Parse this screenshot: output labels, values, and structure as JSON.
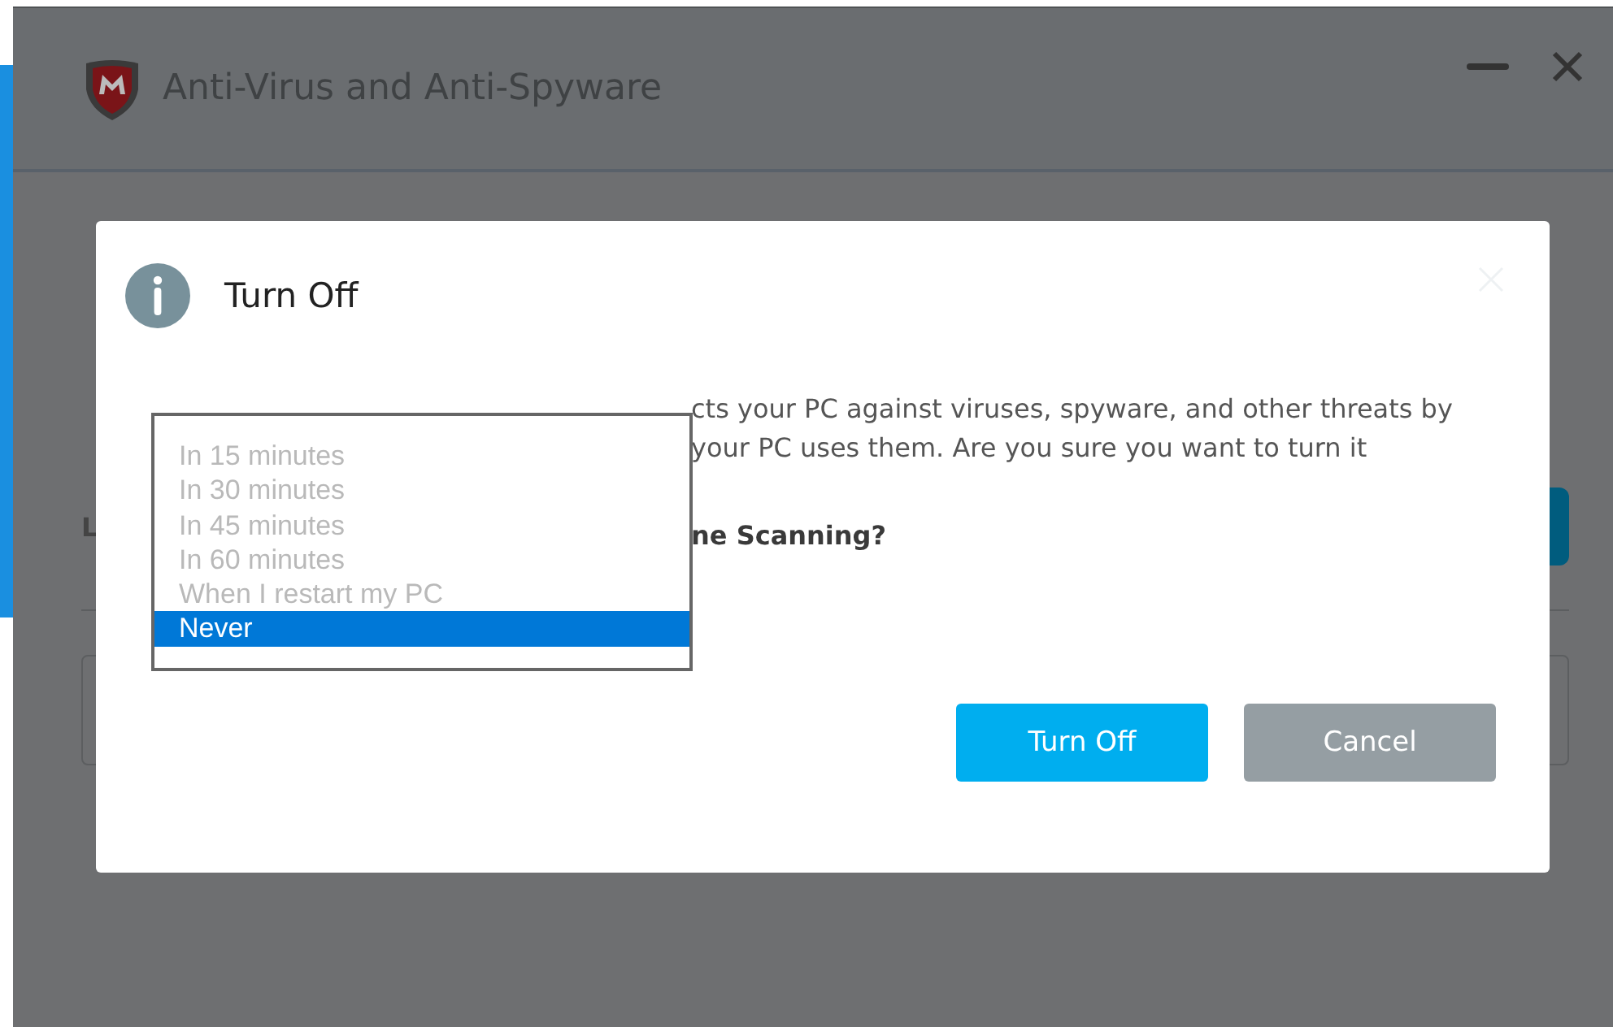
{
  "window": {
    "title": "Anti-Virus and Anti-Spyware"
  },
  "background": {
    "section_label": "L"
  },
  "dialog": {
    "title": "Turn Off",
    "message_lines": [
      "cts your PC against viruses, spyware, and other threats by",
      "your PC uses them. Are you sure you want to turn it"
    ],
    "question": "ne Scanning?",
    "dropdown": {
      "options": [
        {
          "label": "In 15 minutes",
          "selected": false
        },
        {
          "label": "In 30 minutes",
          "selected": false
        },
        {
          "label": "In 45 minutes",
          "selected": false
        },
        {
          "label": "In 60 minutes",
          "selected": false
        },
        {
          "label": "When I restart my PC",
          "selected": false
        },
        {
          "label": "Never",
          "selected": true
        }
      ]
    },
    "buttons": [
      {
        "label": "Turn Off",
        "kind": "primary"
      },
      {
        "label": "Cancel",
        "kind": "secondary"
      }
    ]
  }
}
